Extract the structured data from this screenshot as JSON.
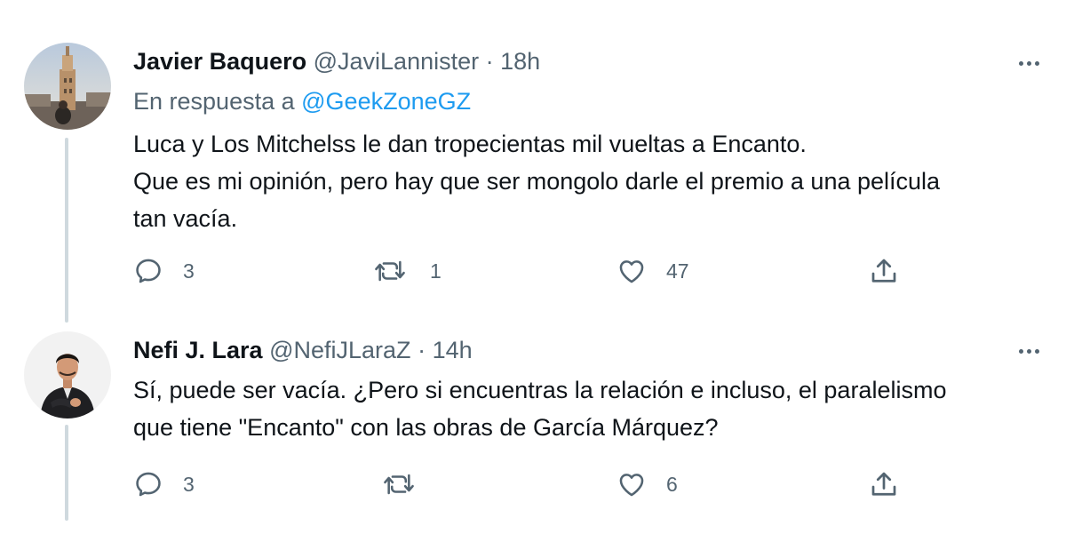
{
  "tweets": [
    {
      "name": "Javier Baquero",
      "handle": "@JaviLannister",
      "separator": "·",
      "time": "18h",
      "reply_prefix": "En respuesta a",
      "reply_mention": "@GeekZoneGZ",
      "lines": [
        "Luca y Los Mitchelss le dan tropecientas mil vueltas a Encanto.",
        "Que es mi opinión, pero hay que ser mongolo darle el premio a una película",
        "tan vacía."
      ],
      "actions": {
        "replies": "3",
        "retweets": "1",
        "likes": "47"
      }
    },
    {
      "name": "Nefi J. Lara",
      "handle": "@NefiJLaraZ",
      "separator": "·",
      "time": "14h",
      "lines": [
        "Sí, puede ser vacía. ¿Pero si encuentras la relación e incluso, el paralelismo",
        "que tiene \"Encanto\" con las obras de García Márquez?"
      ],
      "actions": {
        "replies": "3",
        "likes": "6"
      }
    }
  ],
  "icons": [
    "reply-icon",
    "retweet-icon",
    "like-icon",
    "share-icon",
    "more-icon"
  ],
  "colors": {
    "text": "#0f1419",
    "secondary": "#536471",
    "link": "#1d9bf0",
    "thread": "#cfd9de"
  }
}
